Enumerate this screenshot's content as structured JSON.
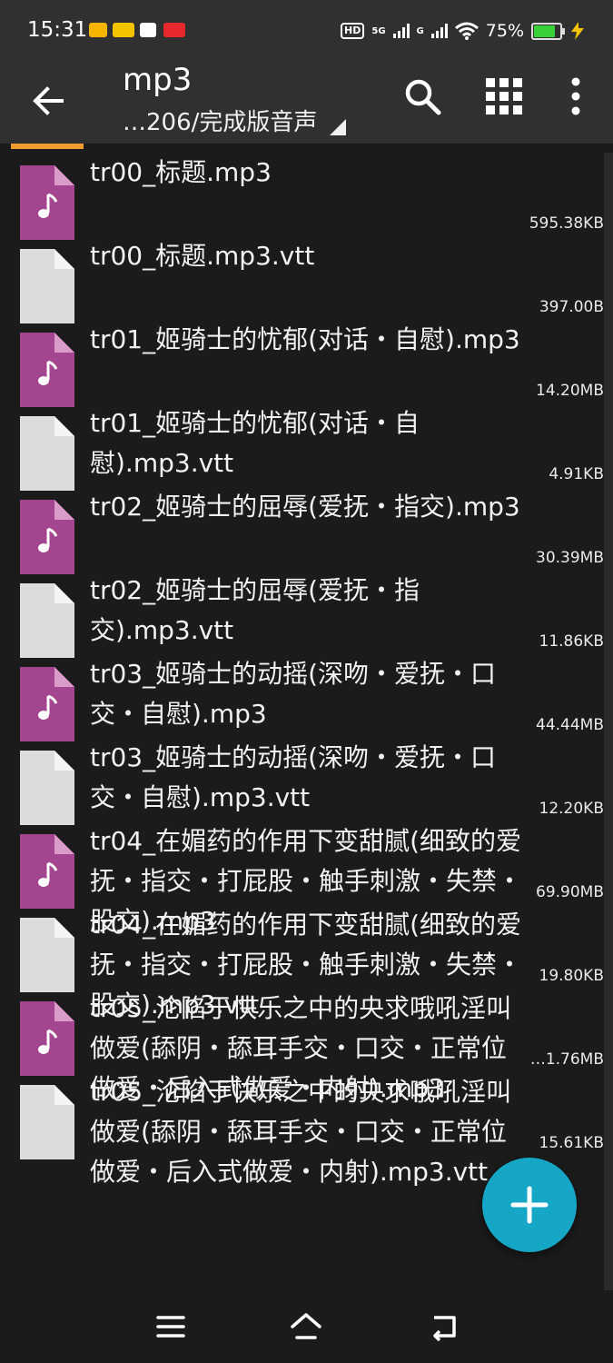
{
  "status": {
    "time": "15:31",
    "network_5g": "5G",
    "network_g": "G",
    "hd": "HD",
    "battery": "75%",
    "battery_level": 0.75,
    "app_icons": [
      "mail-notification-icon",
      "meituan-notification-icon",
      "app-notification-icon",
      "red-app-notification-icon"
    ]
  },
  "toolbar": {
    "title": "mp3",
    "subtitle": "…206/完成版音声",
    "icons": [
      "back-arrow-icon",
      "search-icon",
      "grid-view-icon",
      "more-vert-icon"
    ]
  },
  "files": [
    {
      "name": "tr00_标题.mp3",
      "size": "595.38KB",
      "type": "audio"
    },
    {
      "name": "tr00_标题.mp3.vtt",
      "size": "397.00B",
      "type": "doc"
    },
    {
      "name": "tr01_姬骑士的忧郁(对话・自慰).mp3",
      "size": "14.20MB",
      "type": "audio"
    },
    {
      "name": "tr01_姬骑士的忧郁(对话・自慰).mp3.vtt",
      "size": "4.91KB",
      "type": "doc"
    },
    {
      "name": "tr02_姬骑士的屈辱(爱抚・指交).mp3",
      "size": "30.39MB",
      "type": "audio"
    },
    {
      "name": "tr02_姬骑士的屈辱(爱抚・指交).mp3.vtt",
      "size": "11.86KB",
      "type": "doc"
    },
    {
      "name": "tr03_姬骑士的动摇(深吻・爱抚・口交・自慰).mp3",
      "size": "44.44MB",
      "type": "audio"
    },
    {
      "name": "tr03_姬骑士的动摇(深吻・爱抚・口交・自慰).mp3.vtt",
      "size": "12.20KB",
      "type": "doc"
    },
    {
      "name": "tr04_在媚药的作用下变甜腻(细致的爱抚・指交・打屁股・触手刺激・失禁・股交).mp3",
      "size": "69.90MB",
      "type": "audio"
    },
    {
      "name": "tr04_在媚药的作用下变甜腻(细致的爱抚・指交・打屁股・触手刺激・失禁・股交).mp3.vtt",
      "size": "19.80KB",
      "type": "doc"
    },
    {
      "name": "tr05_沦陷于快乐之中的央求哦吼淫叫做爱(舔阴・舔耳手交・口交・正常位做爱・后入式做爱・内射).mp3",
      "size": "…1.76MB",
      "type": "audio"
    },
    {
      "name": "tr05_沦陷于快乐之中的央求哦吼淫叫做爱(舔阴・舔耳手交・口交・正常位做爱・后入式做爱・内射).mp3.vtt",
      "size": "15.61KB",
      "type": "doc"
    }
  ],
  "fab": {
    "icon": "add-icon"
  },
  "navbar": {
    "icons": [
      "menu-icon",
      "home-icon",
      "back-icon"
    ]
  },
  "colors": {
    "audio_icon": "#a4458f",
    "doc_icon": "#dcdcdc",
    "fab": "#16a7c6",
    "tab_indicator": "#f29b2e",
    "toolbar": "#303030",
    "background": "#1b1b1b"
  }
}
